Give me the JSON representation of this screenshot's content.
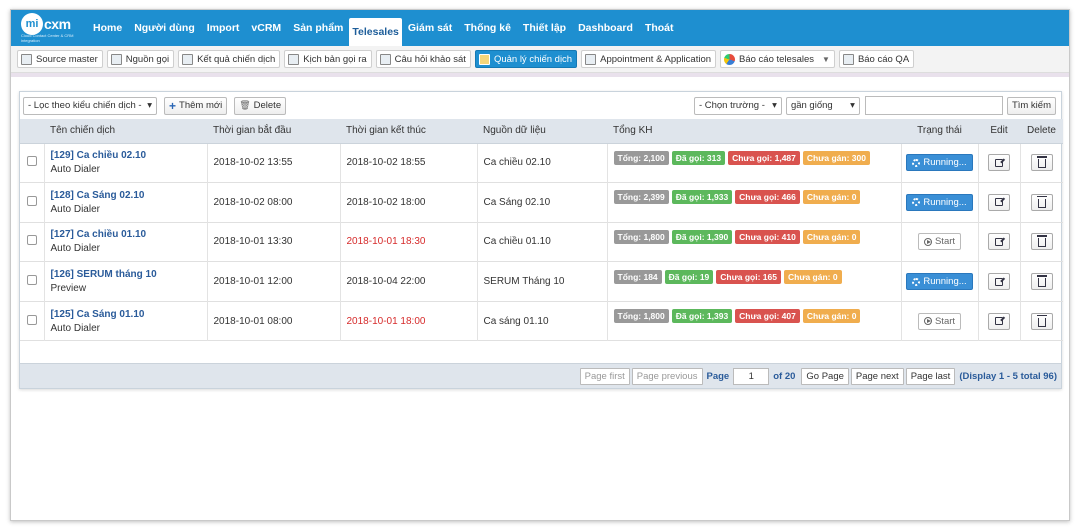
{
  "logo": {
    "mark": "mi",
    "text": "cxm",
    "sub": "Cloud Contact Center & CRM integration"
  },
  "topnav": [
    {
      "label": "Home"
    },
    {
      "label": "Người dùng"
    },
    {
      "label": "Import"
    },
    {
      "label": "vCRM"
    },
    {
      "label": "Sản phẩm"
    },
    {
      "label": "Telesales",
      "active": true
    },
    {
      "label": "Giám sát"
    },
    {
      "label": "Thống kê"
    },
    {
      "label": "Thiết lập"
    },
    {
      "label": "Dashboard"
    },
    {
      "label": "Thoát"
    }
  ],
  "subnav": [
    {
      "label": "Source master",
      "icon": "list-icon"
    },
    {
      "label": "Nguồn gọi",
      "icon": "list-icon"
    },
    {
      "label": "Kết quả chiến dịch",
      "icon": "report-icon"
    },
    {
      "label": "Kịch bản gọi ra",
      "icon": "script-icon"
    },
    {
      "label": "Câu hỏi khảo sát",
      "icon": "survey-icon"
    },
    {
      "label": "Quản lý chiến dịch",
      "icon": "campaign-icon",
      "active": true
    },
    {
      "label": "Appointment & Application",
      "icon": "document-icon"
    },
    {
      "label": "Báo cáo telesales",
      "icon": "pie-chart-icon",
      "dropdown": true
    },
    {
      "label": "Báo cáo QA",
      "icon": "document-icon"
    }
  ],
  "toolbar": {
    "filter": "- Lọc theo kiểu chiến dịch -",
    "add": "Thêm mới",
    "delete": "Delete",
    "field": "- Chọn trường -",
    "op": "gần giống",
    "search_value": "",
    "search": "Tìm kiếm"
  },
  "columns": [
    "Tên chiến dịch",
    "Thời gian bắt đầu",
    "Thời gian kết thúc",
    "Nguồn dữ liệu",
    "Tổng KH",
    "Trạng thái",
    "Edit",
    "Delete"
  ],
  "rows": [
    {
      "name": "[129] Ca chiều 02.10",
      "type": "Auto Dialer",
      "start": "2018-10-02 13:55",
      "end": "2018-10-02 18:55",
      "end_late": false,
      "source": "Ca chiều 02.10",
      "badges": {
        "total": "Tổng: 2,100",
        "called": "Đã gọi: 313",
        "not_called": "Chưa gọi: 1,487",
        "unassigned": "Chưa gán: 300"
      },
      "status": "Running...",
      "running": true
    },
    {
      "name": "[128] Ca Sáng 02.10",
      "type": "Auto Dialer",
      "start": "2018-10-02 08:00",
      "end": "2018-10-02 18:00",
      "end_late": false,
      "source": "Ca Sáng 02.10",
      "badges": {
        "total": "Tổng: 2,399",
        "called": "Đã gọi: 1,933",
        "not_called": "Chưa gọi: 466",
        "unassigned": "Chưa gán: 0"
      },
      "status": "Running...",
      "running": true
    },
    {
      "name": "[127] Ca chiều 01.10",
      "type": "Auto Dialer",
      "start": "2018-10-01 13:30",
      "end": "2018-10-01 18:30",
      "end_late": true,
      "source": "Ca chiều 01.10",
      "badges": {
        "total": "Tổng: 1,800",
        "called": "Đã gọi: 1,390",
        "not_called": "Chưa gọi: 410",
        "unassigned": "Chưa gán: 0"
      },
      "status": "Start",
      "running": false
    },
    {
      "name": "[126] SERUM tháng 10",
      "type": "Preview",
      "start": "2018-10-01 12:00",
      "end": "2018-10-04 22:00",
      "end_late": false,
      "source": "SERUM Tháng 10",
      "badges": {
        "total": "Tổng: 184",
        "called": "Đã gọi: 19",
        "not_called": "Chưa gọi: 165",
        "unassigned": "Chưa gán: 0"
      },
      "status": "Running...",
      "running": true
    },
    {
      "name": "[125] Ca Sáng 01.10",
      "type": "Auto Dialer",
      "start": "2018-10-01 08:00",
      "end": "2018-10-01 18:00",
      "end_late": true,
      "source": "Ca sáng 01.10",
      "badges": {
        "total": "Tổng: 1,800",
        "called": "Đã gọi: 1,393",
        "not_called": "Chưa gọi: 407",
        "unassigned": "Chưa gán: 0"
      },
      "status": "Start",
      "running": false
    }
  ],
  "pager": {
    "first": "Page first",
    "previous": "Page previous",
    "page_label": "Page",
    "page_value": "1",
    "of": "of 20",
    "go": "Go Page",
    "next": "Page next",
    "last": "Page last",
    "display": "(Display 1 - 5 total 96)"
  },
  "colors": {
    "nav": "#1e8fd0",
    "link": "#2a5b9a",
    "late": "#d62b2b",
    "running": "#3a8fd6"
  }
}
